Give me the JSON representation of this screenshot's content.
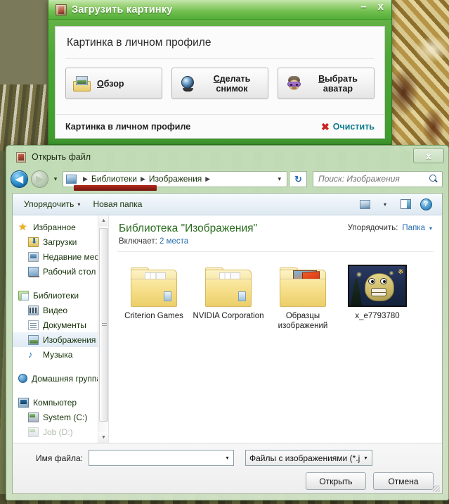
{
  "upload_window": {
    "title": "Загрузить картинку",
    "icon": "picture-file-icon",
    "minimize_label": "–",
    "close_label": "x",
    "panel_heading": "Картинка в личном профиле",
    "buttons": [
      {
        "label_prefix": "О",
        "label_rest": "бзор",
        "icon": "folder-picture-icon",
        "layout": "inline"
      },
      {
        "label_prefix": "С",
        "label_rest": "делать",
        "label_line2": "снимок",
        "icon": "webcam-icon",
        "layout": "stacked"
      },
      {
        "label_prefix": "В",
        "label_rest": "ыбрать",
        "label_line2": "аватар",
        "icon": "avatar-mask-icon",
        "layout": "stacked"
      }
    ],
    "footer_label": "Картинка в личном профиле",
    "clear_icon": "red-x-icon",
    "clear_label": "Очистить",
    "colors": {
      "titlebar": "#66b246",
      "clear_link": "#0d7a8c",
      "clear_x": "#cc2020"
    }
  },
  "open_dialog": {
    "title": "Открыть файл",
    "icon": "picture-file-icon",
    "close_label": "x",
    "nav": {
      "back_label": "◀",
      "forward_label": "▶",
      "recent_label": "▾",
      "refresh_label": "↻",
      "breadcrumbs": [
        "Библиотеки",
        "Изображения"
      ],
      "address_dropdown_label": "▾",
      "address_icon": "library-pictures-icon"
    },
    "search": {
      "placeholder": "Поиск: Изображения",
      "icon": "search-icon",
      "value": ""
    },
    "command_bar": {
      "organize_label": "Упорядочить",
      "organize_caret": "▾",
      "new_folder_label": "Новая папка",
      "view_icon": "view-mode-icon",
      "view_caret": "▾",
      "preview_icon": "preview-pane-icon",
      "help_icon": "help-icon",
      "help_glyph": "?"
    },
    "nav_pane": {
      "groups": [
        {
          "items": [
            {
              "label": "Избранное",
              "icon": "star-icon",
              "level": 0
            },
            {
              "label": "Загрузки",
              "icon": "downloads-icon",
              "level": 1
            },
            {
              "label": "Недавние места",
              "icon": "recent-places-icon",
              "level": 1
            },
            {
              "label": "Рабочий стол",
              "icon": "desktop-icon",
              "level": 1
            }
          ]
        },
        {
          "items": [
            {
              "label": "Библиотеки",
              "icon": "libraries-icon",
              "level": 0
            },
            {
              "label": "Видео",
              "icon": "video-library-icon",
              "level": 1
            },
            {
              "label": "Документы",
              "icon": "documents-library-icon",
              "level": 1
            },
            {
              "label": "Изображения",
              "icon": "pictures-library-icon",
              "level": 1,
              "selected": true
            },
            {
              "label": "Музыка",
              "icon": "music-library-icon",
              "level": 1
            }
          ]
        },
        {
          "items": [
            {
              "label": "Домашняя группа",
              "icon": "homegroup-icon",
              "level": 0
            }
          ]
        },
        {
          "items": [
            {
              "label": "Компьютер",
              "icon": "computer-icon",
              "level": 0
            },
            {
              "label": "System (C:)",
              "icon": "drive-icon",
              "level": 1
            },
            {
              "label": "Job (D:)",
              "icon": "drive-icon",
              "level": 1,
              "partial": true
            }
          ]
        }
      ],
      "scrollbar": {
        "up_label": "▲",
        "down_label": "▼"
      }
    },
    "library": {
      "title": "Библиотека \"Изображения\"",
      "includes_label": "Включает:",
      "includes_value": "2 места",
      "arrange_label": "Упорядочить:",
      "arrange_value": "Папка",
      "arrange_caret": "▾"
    },
    "items": [
      {
        "name": "Criterion Games",
        "type": "folder",
        "icon": "folder-icon"
      },
      {
        "name": "NVIDIA Corporation",
        "type": "folder",
        "icon": "folder-icon"
      },
      {
        "name": "Образцы изображений",
        "type": "folder-with-pictures",
        "icon": "folder-pictures-icon"
      },
      {
        "name": "x_e7793780",
        "type": "image",
        "icon": "image-thumbnail"
      }
    ],
    "footer": {
      "filename_label": "Имя файла:",
      "filename_value": "",
      "filename_caret": "▾",
      "filetype_value": "Файлы с изображениями (*.jp",
      "filetype_caret": "▾",
      "open_button": "Открыть",
      "cancel_button": "Отмена"
    }
  }
}
